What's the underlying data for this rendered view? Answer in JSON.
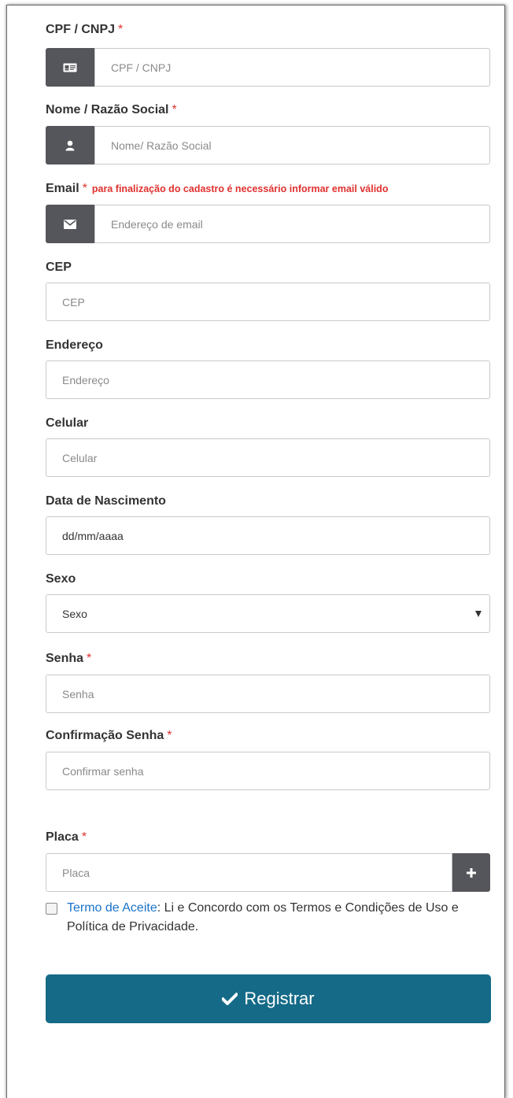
{
  "form": {
    "cpf": {
      "label": "CPF / CNPJ",
      "required": "*",
      "placeholder": "CPF / CNPJ",
      "icon": "id-card-icon"
    },
    "nome": {
      "label": "Nome / Razão Social",
      "required": "*",
      "placeholder": "Nome/ Razão Social",
      "icon": "user-icon"
    },
    "email": {
      "label": "Email",
      "required": "*",
      "hint": "para finalização do cadastro é necessário informar email válido",
      "placeholder": "Endereço de email",
      "icon": "envelope-icon"
    },
    "cep": {
      "label": "CEP",
      "placeholder": "CEP"
    },
    "endereco": {
      "label": "Endereço",
      "placeholder": "Endereço"
    },
    "celular": {
      "label": "Celular",
      "placeholder": "Celular"
    },
    "nascimento": {
      "label": "Data de Nascimento",
      "value": "dd/mm/aaaa"
    },
    "sexo": {
      "label": "Sexo",
      "selected": "Sexo"
    },
    "senha": {
      "label": "Senha",
      "required": "*",
      "placeholder": "Senha"
    },
    "confirmacao": {
      "label": "Confirmação Senha",
      "required": "*",
      "placeholder": "Confirmar senha"
    },
    "placa": {
      "label": "Placa",
      "required": "*",
      "placeholder": "Placa",
      "icon": "plus-icon"
    }
  },
  "terms": {
    "link_text": "Termo de Aceite",
    "text": ": Li e Concordo com os Termos e Condições de Uso e Política de Privacidade."
  },
  "submit": {
    "label": "Registrar",
    "icon": "check-icon"
  },
  "colors": {
    "addon": "#55565b",
    "required": "#e0312f",
    "link": "#1a73c9",
    "button": "#146a87"
  }
}
